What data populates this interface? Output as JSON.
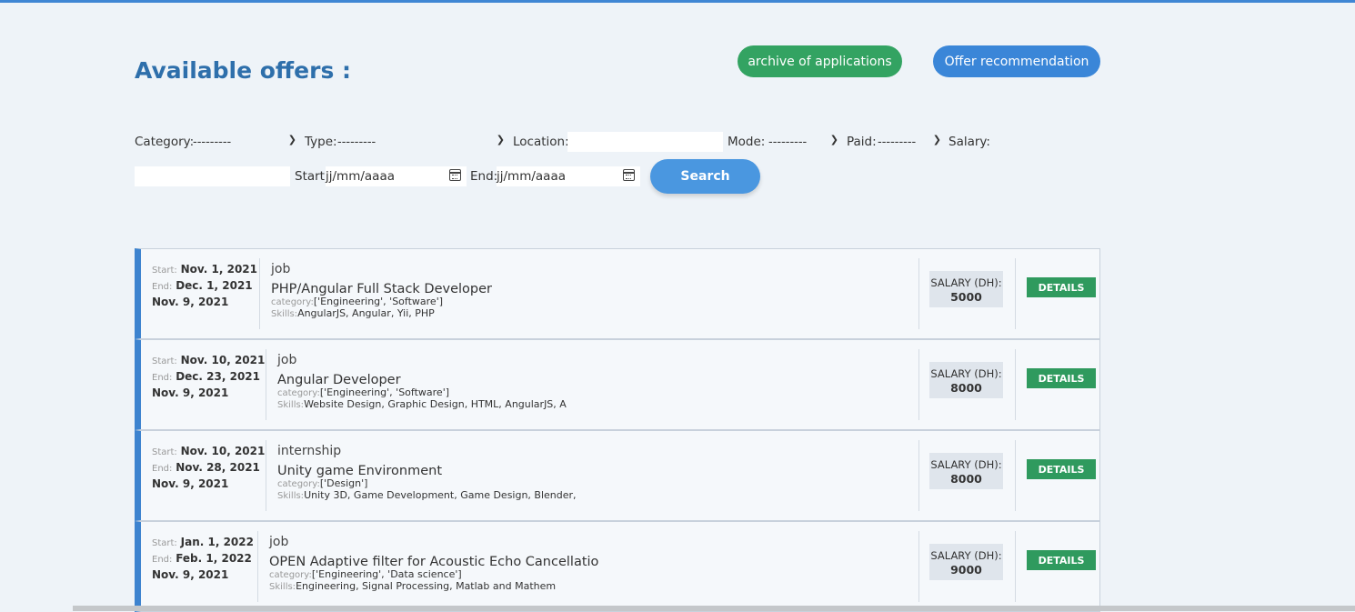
{
  "header": {
    "title": "Available offers :",
    "archive_button": "archive of applications",
    "recommend_button": "Offer recommendation"
  },
  "filters": {
    "category_label": "Category:",
    "category_value": "---------",
    "type_label": "Type:",
    "type_value": "---------",
    "location_label": "Location:",
    "mode_label": "Mode:",
    "mode_value": "---------",
    "paid_label": "Paid:",
    "paid_value": "---------",
    "salary_label": "Salary:",
    "start_label": "Start:",
    "start_placeholder": "jj/mm/aaaa",
    "end_label": "End:",
    "end_placeholder": "jj/mm/aaaa",
    "search_button": "Search"
  },
  "offers": [
    {
      "start_key": "Start:",
      "start": "Nov. 1, 2021",
      "end_key": "End:",
      "end": "Dec. 1, 2021",
      "published": "Nov. 9, 2021",
      "type": "job",
      "title": "PHP/Angular Full Stack Developer",
      "category_key": "category:",
      "category": "['Engineering', 'Software']",
      "skills_key": "Skills:",
      "skills": "AngularJS, Angular, Yii, PHP",
      "salary_label": "SALARY (DH):",
      "salary": "5000",
      "details": "DETAILS"
    },
    {
      "start_key": "Start:",
      "start": "Nov. 10, 2021",
      "end_key": "End:",
      "end": "Dec. 23, 2021",
      "published": "Nov. 9, 2021",
      "type": "job",
      "title": "Angular Developer",
      "category_key": "category:",
      "category": "['Engineering', 'Software']",
      "skills_key": "Skills:",
      "skills": "Website Design, Graphic Design, HTML, AngularJS, A",
      "salary_label": "SALARY (DH):",
      "salary": "8000",
      "details": "DETAILS"
    },
    {
      "start_key": "Start:",
      "start": "Nov. 10, 2021",
      "end_key": "End:",
      "end": "Nov. 28, 2021",
      "published": "Nov. 9, 2021",
      "type": "internship",
      "title": "Unity game Environment",
      "category_key": "category:",
      "category": "['Design']",
      "skills_key": "Skills:",
      "skills": "Unity 3D, Game Development, Game Design, Blender,",
      "salary_label": "SALARY (DH):",
      "salary": "8000",
      "details": "DETAILS"
    },
    {
      "start_key": "Start:",
      "start": "Jan. 1, 2022",
      "end_key": "End:",
      "end": "Feb. 1, 2022",
      "published": "Nov. 9, 2021",
      "type": "job",
      "title": "OPEN Adaptive filter for Acoustic Echo Cancellatio",
      "category_key": "category:",
      "category": "['Engineering', 'Data science']",
      "skills_key": "Skills:",
      "skills": "Engineering, Signal Processing, Matlab and Mathem",
      "salary_label": "SALARY (DH):",
      "salary": "9000",
      "details": "DETAILS"
    }
  ]
}
